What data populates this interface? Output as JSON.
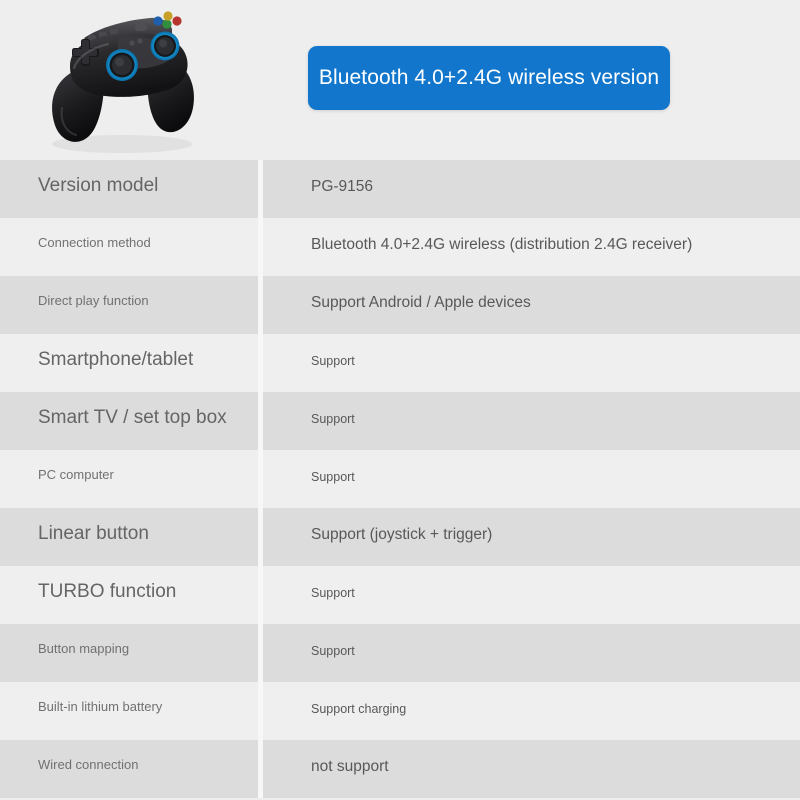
{
  "header": {
    "photo": {
      "icon": "gamepad-photo",
      "alt": "Black wireless gamepad with blue illuminated analog sticks"
    },
    "banner": {
      "text": "Bluetooth 4.0+2.4G wireless version",
      "background_color": "#1277cc",
      "text_color": "#ffffff"
    }
  },
  "colors": {
    "page_background": "#eeeeee",
    "row_dark": "#dcdcdc",
    "row_light": "#efefef",
    "divider": "#f7f7f7",
    "accent_blue": "#1277cc",
    "label_text": "#6d6d6d",
    "value_text": "#585858"
  },
  "spec_table": {
    "rows": [
      {
        "label": "Version model",
        "value": "PG-9156",
        "label_size": "lg",
        "value_size": "lg",
        "shade": "dark"
      },
      {
        "label": "Connection method",
        "value": "Bluetooth 4.0+2.4G wireless (distribution 2.4G receiver)",
        "label_size": "sm",
        "value_size": "lg",
        "shade": "light"
      },
      {
        "label": "Direct play function",
        "value": "Support Android / Apple devices",
        "label_size": "sm",
        "value_size": "lg",
        "shade": "dark"
      },
      {
        "label": "Smartphone/tablet",
        "value": "Support",
        "label_size": "lg",
        "value_size": "sm",
        "shade": "light"
      },
      {
        "label": "Smart TV / set top box",
        "value": "Support",
        "label_size": "lg",
        "value_size": "sm",
        "shade": "dark"
      },
      {
        "label": "PC computer",
        "value": "Support",
        "label_size": "sm",
        "value_size": "sm",
        "shade": "light"
      },
      {
        "label": "Linear button",
        "value": "Support (joystick + trigger)",
        "label_size": "lg",
        "value_size": "lg",
        "shade": "dark"
      },
      {
        "label": "TURBO function",
        "value": "Support",
        "label_size": "lg",
        "value_size": "sm",
        "shade": "light"
      },
      {
        "label": "Button mapping",
        "value": "Support",
        "label_size": "sm",
        "value_size": "sm",
        "shade": "dark"
      },
      {
        "label": "Built-in lithium battery",
        "value": "Support charging",
        "label_size": "sm",
        "value_size": "sm",
        "shade": "light"
      },
      {
        "label": "Wired connection",
        "value": "not support",
        "label_size": "sm",
        "value_size": "lg",
        "shade": "dark"
      }
    ]
  }
}
